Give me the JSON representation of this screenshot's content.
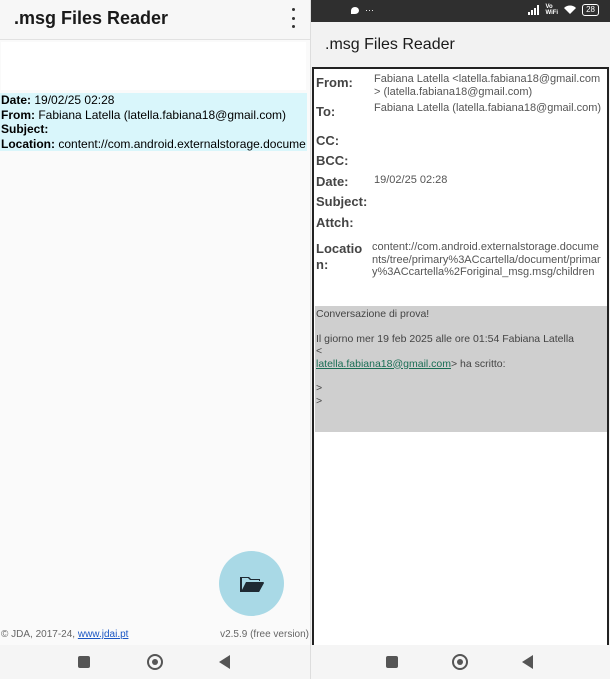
{
  "left": {
    "app_title": ".msg Files Reader",
    "info": {
      "date_label": "Date:",
      "date_value": "19/02/25 02:28",
      "from_label": "From:",
      "from_value": "Fabiana Latella (latella.fabiana18@gmail.com)",
      "subject_label": "Subject:",
      "location_label": "Location:",
      "location_value": "content://com.android.externalstorage.docume"
    },
    "fab_icon": "folder-open-icon",
    "footer": {
      "copyright_prefix": "© JDA, 2017-24, ",
      "link": "www.jdai.pt",
      "version": "v2.5.9 (free version)"
    }
  },
  "right": {
    "status": {
      "left_dots": "···",
      "vo": "Vo",
      "wifi_label": "WiFi",
      "battery": "28"
    },
    "app_title": ".msg Files Reader",
    "headers": {
      "from_label": "From:",
      "from_value": "Fabiana Latella <latella.fabiana18@gmail.com> (latella.fabiana18@gmail.com)",
      "to_label": "To:",
      "to_value": "Fabiana Latella (latella.fabiana18@gmail.com)",
      "cc_label": "CC:",
      "bcc_label": "BCC:",
      "date_label": "Date:",
      "date_value": "19/02/25 02:28",
      "subject_label": "Subject:",
      "attch_label": "Attch:",
      "location_label": "Location:",
      "location_value": "content://com.android.externalstorage.documents/tree/primary%3ACcartella/document/primary%3ACcartella%2Foriginal_msg.msg/children"
    },
    "message": {
      "line1": "Conversazione di prova!",
      "line2": "Il giorno mer 19 feb 2025 alle ore 01:54 Fabiana Latella",
      "line3": "<",
      "email_link": "latella.fabiana18@gmail.com",
      "line4_suffix": "> ha scritto:",
      "quote1": ">",
      "quote2": ">"
    }
  },
  "colors": {
    "info_bg": "#d9f6fb",
    "fab_bg": "#a9d9e6",
    "message_bg": "#cfcfcf",
    "link": "#1a56c4"
  }
}
